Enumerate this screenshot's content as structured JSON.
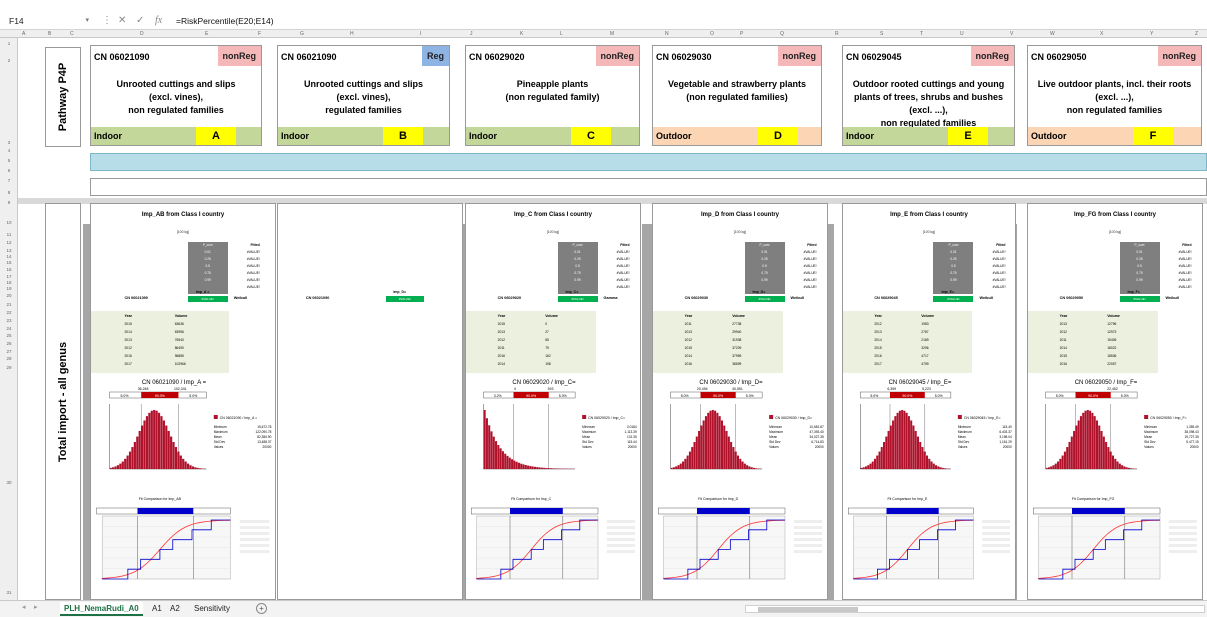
{
  "formula_bar": {
    "cell_ref": "F14",
    "cancel_icon": "cancel-icon",
    "enter_icon": "check-icon",
    "fx_label": "fx",
    "formula": "=RiskPercentile(E20;E14)"
  },
  "column_headers": [
    "A",
    "B",
    "C",
    "D",
    "E",
    "F",
    "G",
    "H",
    "I",
    "J",
    "K",
    "L",
    "M",
    "N",
    "O",
    "P",
    "Q",
    "R",
    "S",
    "T",
    "U",
    "V",
    "W",
    "X",
    "Y",
    "Z"
  ],
  "side_labels": {
    "pathway": "Pathway P4P",
    "total": "Total import - all genus"
  },
  "commodities": [
    {
      "cn": "CN 06021090",
      "reg": "nonReg",
      "desc": [
        "Unrooted cuttings and slips",
        "(excl. vines),",
        "non regulated families"
      ],
      "env": "Indoor",
      "letter": "A",
      "env_color": "#c4d79b"
    },
    {
      "cn": "CN 06021090",
      "reg": "Reg",
      "desc": [
        "Unrooted cuttings and slips",
        "(excl. vines),",
        "regulated families"
      ],
      "env": "Indoor",
      "letter": "B",
      "env_color": "#c4d79b"
    },
    {
      "cn": "CN 06029020",
      "reg": "nonReg",
      "desc": [
        "Pineapple plants",
        "(non regulated family)"
      ],
      "env": "Indoor",
      "letter": "C",
      "env_color": "#c4d79b"
    },
    {
      "cn": "CN 06029030",
      "reg": "nonReg",
      "desc": [
        "Vegetable and strawberry plants",
        "(non regulated families)"
      ],
      "env": "Outdoor",
      "letter": "D",
      "env_color": "#fcd5b4"
    },
    {
      "cn": "CN 06029045",
      "reg": "nonReg",
      "desc": [
        "Outdoor rooted cuttings and young",
        "plants of trees, shrubs and bushes",
        "(excl. ...),",
        "non regulated families"
      ],
      "env": "Indoor",
      "letter": "E",
      "env_color": "#c4d79b"
    },
    {
      "cn": "CN 06029050",
      "reg": "nonReg",
      "desc": [
        "Live outdoor plants, incl. their roots",
        "(excl. ...),",
        "non regulated families"
      ],
      "env": "Outdoor",
      "letter": "F",
      "env_color": "#fcd5b4"
    }
  ],
  "panels": [
    {
      "title": "Imp_AB from Class I country",
      "unit": "[100 kg]",
      "cn": "CN 06021090",
      "imp": "Imp_A =",
      "fit": "#VALUE!",
      "dist": "Weibull",
      "years": [
        "2015",
        "2014",
        "2013",
        "2012",
        "2016",
        "2017"
      ],
      "volumes": [
        "63636",
        "63956",
        "76540",
        "86490",
        "96885",
        "102966"
      ],
      "chart_title": "CN 06021090 / Imp_A =",
      "p_lo": "5.0%",
      "p_mid": "90.0%",
      "p_hi": "5.0%",
      "q_lo": "36,248",
      "q_hi": "102,341",
      "legend": "CN 06021090 / Imp_A =",
      "stats": [
        [
          "Minimum",
          "15,672.78"
        ],
        [
          "Maximum",
          "122,090.78"
        ],
        [
          "Mean",
          "82,356.90"
        ],
        [
          "Std Dev",
          "13,488.37"
        ],
        [
          "Values",
          "20000"
        ]
      ],
      "fit_title": "Fit Comparison for Imp_AB"
    },
    {
      "cn": "CN 06021090",
      "imp": "Imp_D=",
      "fit": "#VALUE!"
    },
    {
      "title": "Imp_C from Class I country",
      "unit": "[100 kg]",
      "cn": "CN 06029020",
      "imp": "Imp_C=",
      "fit": "#VALUE!",
      "dist": "Gamma",
      "years": [
        "2015",
        "2013",
        "2012",
        "2011",
        "2016",
        "2014"
      ],
      "volumes": [
        "0",
        "27",
        "55",
        "79",
        "162",
        "198"
      ],
      "chart_title": "CN 06029020 / Imp_C=",
      "p_lo": "3.2%",
      "p_mid": "90.0%",
      "p_hi": "5.0%",
      "q_lo": "0",
      "q_hi": "393",
      "legend": "CN 06029020 / Imp_C=",
      "stats": [
        [
          "Minimum",
          "0.0184"
        ],
        [
          "Maximum",
          "1,113.39"
        ],
        [
          "Mean",
          "131.35"
        ],
        [
          "Std Dev",
          "115.44"
        ],
        [
          "Values",
          "20000"
        ]
      ],
      "fit_title": "Fit Comparison for Imp_C"
    },
    {
      "title": "Imp_D from Class I country",
      "unit": "[100 kg]",
      "cn": "CN 06029030",
      "imp": "Imp_D=",
      "fit": "#VALUE!",
      "dist": "Weibull",
      "years": [
        "2011",
        "2013",
        "2012",
        "2015",
        "2014",
        "2016"
      ],
      "volumes": [
        "27738",
        "29940",
        "31938",
        "37209",
        "37959",
        "38699"
      ],
      "chart_title": "CN 06029030 / Imp_D=",
      "p_lo": "5.0%",
      "p_mid": "90.0%",
      "p_hi": "5.0%",
      "q_lo": "20,494",
      "q_hi": "40,551",
      "legend": "CN 06029030 / Imp_D=",
      "stats": [
        [
          "Minimum",
          "10,681.87"
        ],
        [
          "Maximum",
          "47,393.40"
        ],
        [
          "Mean",
          "34,027.35"
        ],
        [
          "Std Dev",
          "6,714.83"
        ],
        [
          "Values",
          "20000"
        ]
      ],
      "fit_title": "Fit Comparison for Imp_D"
    },
    {
      "title": "Imp_E from Class I country",
      "unit": "[100 kg]",
      "cn": "CN 06029045",
      "imp": "Imp_E=",
      "fit": "#VALUE!",
      "dist": "Weibull",
      "years": [
        "2012",
        "2013",
        "2014",
        "2015",
        "2016",
        "2017"
      ],
      "volumes": [
        "1983",
        "2787",
        "2189",
        "3296",
        "4717",
        "4759"
      ],
      "chart_title": "CN 06029045 / Imp_E=",
      "p_lo": "5.0%",
      "p_mid": "90.0%",
      "p_hi": "5.0%",
      "q_lo": "6,359",
      "q_hi": "5,223",
      "legend": "CN 06029045 / Imp_E=",
      "stats": [
        [
          "Minimum",
          "115.40"
        ],
        [
          "Maximum",
          "6,403.37"
        ],
        [
          "Mean",
          "3,198.04"
        ],
        [
          "Std Dev",
          "1,161.29"
        ],
        [
          "Values",
          "20000"
        ]
      ],
      "fit_title": "Fit Comparison for Imp_E"
    },
    {
      "title": "Imp_FG from Class I country",
      "unit": "[100 kg]",
      "cn": "CN 06029050",
      "imp": "Imp_F=",
      "fit": "#VALUE!",
      "dist": "Weibull",
      "years": [
        "2013",
        "2012",
        "2011",
        "2014",
        "2015",
        "2016"
      ],
      "volumes": [
        "12796",
        "12973",
        "15405",
        "18022",
        "18536",
        "22057"
      ],
      "chart_title": "CN 06029050 / Imp_F=",
      "p_lo": "5.0%",
      "p_mid": "90.0%",
      "p_hi": "5.0%",
      "q_lo": "",
      "q_hi": "22,452",
      "legend": "CN 06029050 / Imp_F=",
      "stats": [
        [
          "Minimum",
          "1,355.49"
        ],
        [
          "Maximum",
          "38,098.43"
        ],
        [
          "Mean",
          "19,727.35"
        ],
        [
          "Std Dev",
          "5,477.15"
        ],
        [
          "Values",
          "20000"
        ]
      ],
      "fit_title": "Fit Comparison for Imp_FG"
    }
  ],
  "fit_box": {
    "header": "P_cum",
    "fitted": "Fitted",
    "probs": [
      "0.01",
      "0.25",
      "0.5",
      "0.75",
      "0.99"
    ],
    "err": "#VALUE!"
  },
  "sheet_tabs": [
    "PLH_NemaRudi_A0",
    "A1",
    "A2",
    "Sensitivity"
  ],
  "active_tab": "PLH_NemaRudi_A0",
  "colors": {
    "header_bar": "#217346",
    "band_blue": "#b7dee8",
    "panel_gap": "#a6a6a6",
    "bar_red": "#c00000",
    "fit_green": "#00b050"
  }
}
